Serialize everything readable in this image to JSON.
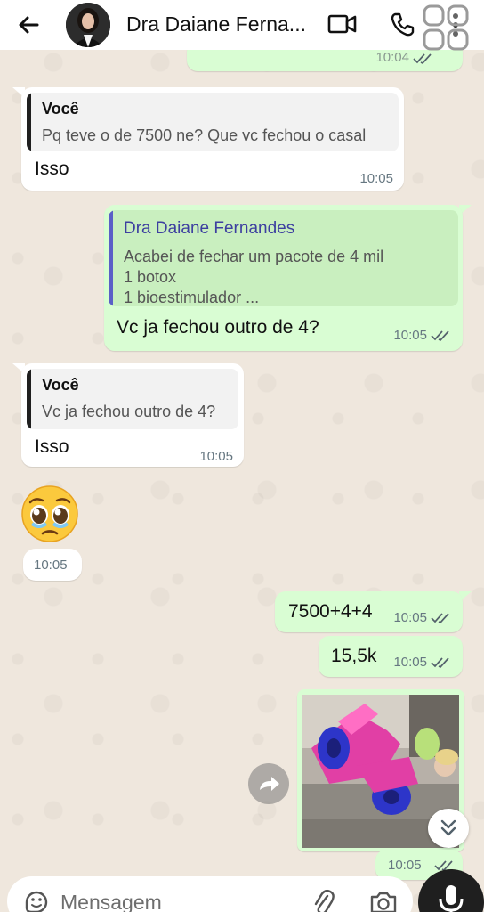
{
  "header": {
    "contact_name": "Dra Daiane Ferna...",
    "icons": [
      "back-arrow-icon",
      "avatar",
      "video-call-icon",
      "phone-icon",
      "more-vert-icon"
    ]
  },
  "messages": [
    {
      "type": "outgoing-partial",
      "time": "10:04"
    },
    {
      "type": "incoming",
      "quote_author": "Você",
      "quote_text": "Pq teve o de 7500 ne? Que vc fechou o casal",
      "text": "Isso",
      "time": "10:05"
    },
    {
      "type": "outgoing",
      "quote_author": "Dra Daiane Fernandes",
      "quote_lines": [
        "Acabei de fechar um pacote de 4 mil",
        "1 botox",
        "1 bioestimulador ..."
      ],
      "text": "Vc ja fechou outro de 4?",
      "time": "10:05"
    },
    {
      "type": "incoming",
      "quote_author": "Você",
      "quote_text": "Vc ja fechou outro de 4?",
      "text": "Isso",
      "time": "10:05"
    },
    {
      "type": "incoming-emoji",
      "emoji": "🥹",
      "time": "10:05"
    },
    {
      "type": "outgoing",
      "text": "7500+4+4",
      "time": "10:05"
    },
    {
      "type": "outgoing",
      "text": "15,5k",
      "time": "10:05"
    },
    {
      "type": "outgoing-image",
      "time": "10:05"
    }
  ],
  "input": {
    "placeholder": "Mensagem"
  },
  "colors": {
    "outgoing_bubble": "#d9fdd3",
    "incoming_bubble": "#ffffff",
    "quote_you": "#111111",
    "quote_contact": "#3d3fa0",
    "quote_bar_you": "#1f1f1f",
    "quote_bar_contact": "#5b5fc7",
    "ticks": "#53616b"
  }
}
